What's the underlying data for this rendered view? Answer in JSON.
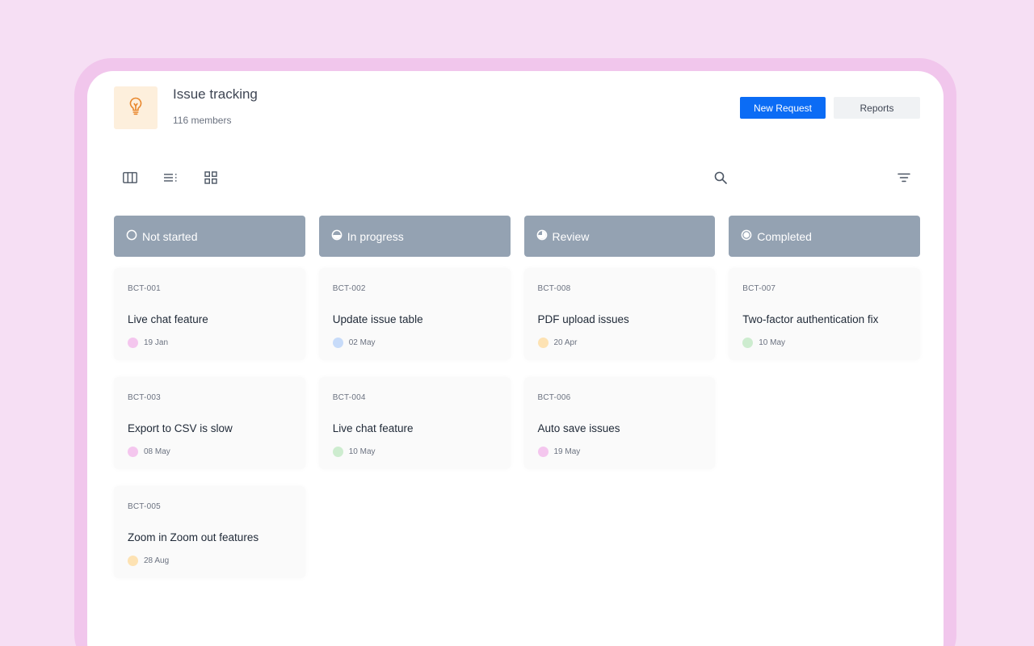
{
  "header": {
    "title": "Issue tracking",
    "members": "116 members",
    "logo_icon": "lightbulb-icon",
    "new_request_label": "New Request",
    "reports_label": "Reports"
  },
  "toolbar": {
    "views": [
      "board-view-icon",
      "list-view-icon",
      "grid-view-icon"
    ],
    "search_icon": "search-icon",
    "filter_icon": "filter-icon"
  },
  "colors": {
    "background": "#f6dff4",
    "bezel": "#f1c6ec",
    "primary": "#0b6cf5",
    "column_header": "#94a2b2",
    "logo_bg": "#fdefdc",
    "logo_icon": "#e8862b"
  },
  "columns": [
    {
      "name": "Not started",
      "status_icon": "empty-circle-icon",
      "cards": [
        {
          "id": "BCT-001",
          "title": "Live chat feature",
          "date": "19 Jan",
          "color": "#f4c6ee"
        },
        {
          "id": "BCT-003",
          "title": "Export to CSV is slow",
          "date": "08 May",
          "color": "#f4c6ee"
        },
        {
          "id": "BCT-005",
          "title": "Zoom in Zoom out features",
          "date": "28 Aug",
          "color": "#fde2b3"
        }
      ]
    },
    {
      "name": "In progress",
      "status_icon": "half-circle-icon",
      "cards": [
        {
          "id": "BCT-002",
          "title": "Update issue table",
          "date": "02 May",
          "color": "#c7dbf9"
        },
        {
          "id": "BCT-004",
          "title": "Live chat feature",
          "date": "10 May",
          "color": "#cdeccf"
        }
      ]
    },
    {
      "name": "Review",
      "status_icon": "three-quarter-circle-icon",
      "cards": [
        {
          "id": "BCT-008",
          "title": "PDF upload issues",
          "date": "20 Apr",
          "color": "#fde2b3"
        },
        {
          "id": "BCT-006",
          "title": "Auto save issues",
          "date": "19 May",
          "color": "#f4c6ee"
        }
      ]
    },
    {
      "name": "Completed",
      "status_icon": "filled-circle-icon",
      "cards": [
        {
          "id": "BCT-007",
          "title": "Two-factor authentication fix",
          "date": "10 May",
          "color": "#cdeccf"
        }
      ]
    }
  ]
}
